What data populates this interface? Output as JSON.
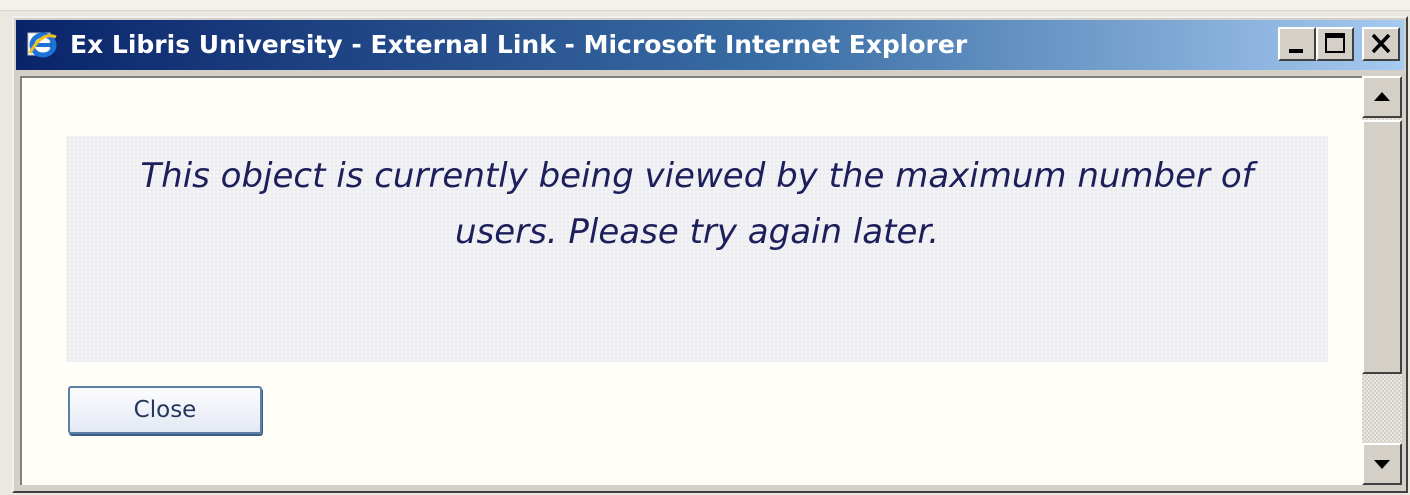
{
  "window": {
    "title": "Ex Libris University - External Link - Microsoft Internet Explorer",
    "app_icon": "internet-explorer-icon",
    "controls": [
      "minimize-icon",
      "maximize-icon",
      "close-icon"
    ]
  },
  "dialog": {
    "message": "This object is currently being viewed by the maximum number of users. Please try again later.",
    "close_label": "Close"
  },
  "scrollbar": {
    "up_icon": "scroll-up-arrow-icon",
    "down_icon": "scroll-down-arrow-icon"
  },
  "colors": {
    "titlebar_start": "#0a246a",
    "titlebar_end": "#a6caf0",
    "message_text": "#1c1f5a",
    "button_border": "#5c7fa6"
  }
}
